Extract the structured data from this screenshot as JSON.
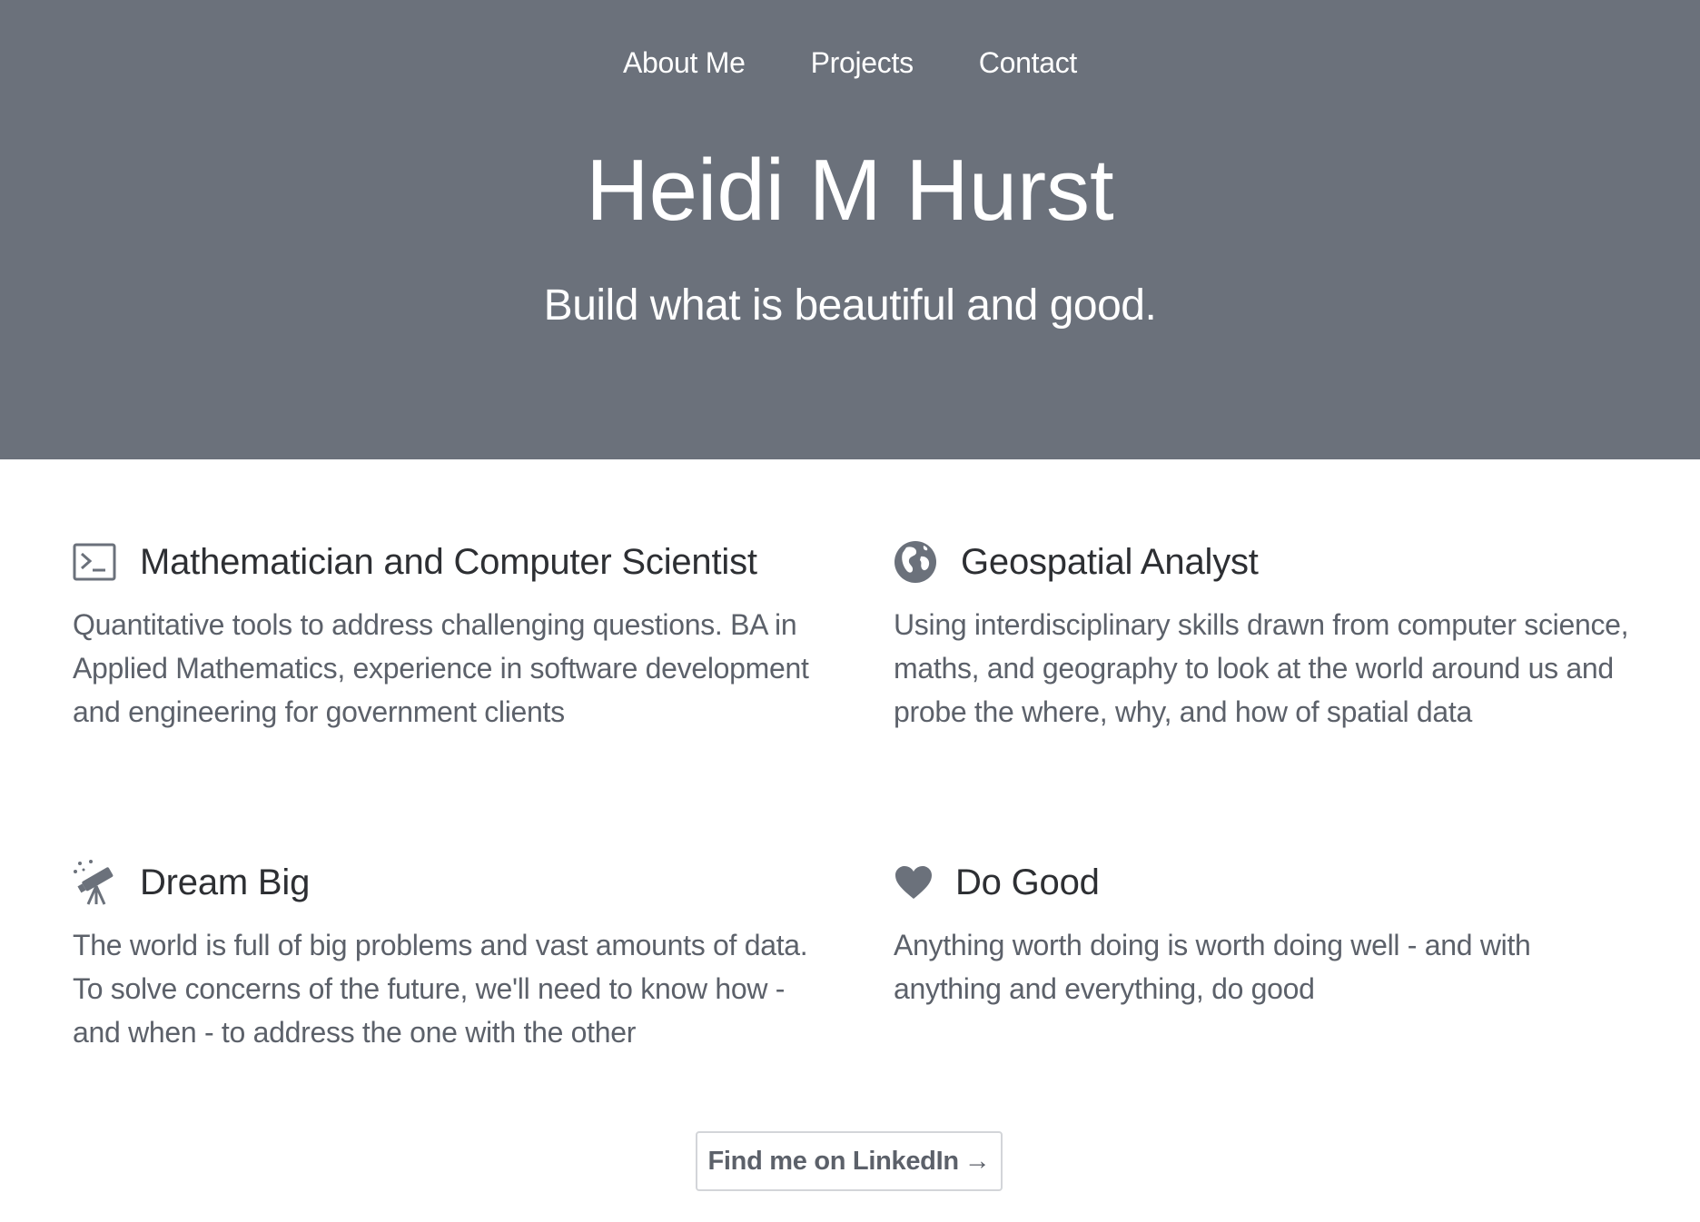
{
  "nav": {
    "items": [
      {
        "label": "About Me"
      },
      {
        "label": "Projects"
      },
      {
        "label": "Contact"
      }
    ]
  },
  "hero": {
    "title": "Heidi M Hurst",
    "tagline": "Build what is beautiful and good."
  },
  "features": [
    {
      "icon": "terminal-icon",
      "title": "Mathematician and Computer Scientist",
      "description": "Quantitative tools to address challenging questions. BA in Applied Mathematics, experience in software development and engineering for government clients"
    },
    {
      "icon": "globe-icon",
      "title": "Geospatial Analyst",
      "description": "Using interdisciplinary skills drawn from computer science, maths, and geography to look at the world around us and probe the where, why, and how of spatial data"
    },
    {
      "icon": "telescope-icon",
      "title": "Dream Big",
      "description": "The world is full of big problems and vast amounts of data. To solve concerns of the future, we'll need to know how - and when - to address the one with the other"
    },
    {
      "icon": "heart-icon",
      "title": "Do Good",
      "description": "Anything worth doing is worth doing well - and with anything and everything, do good"
    }
  ],
  "cta": {
    "label": "Find me on LinkedIn",
    "arrow": "→"
  },
  "colors": {
    "hero_background": "#6b717b",
    "text_dark": "#2d2f33",
    "text_muted": "#5c616a",
    "icon": "#6b717b"
  }
}
